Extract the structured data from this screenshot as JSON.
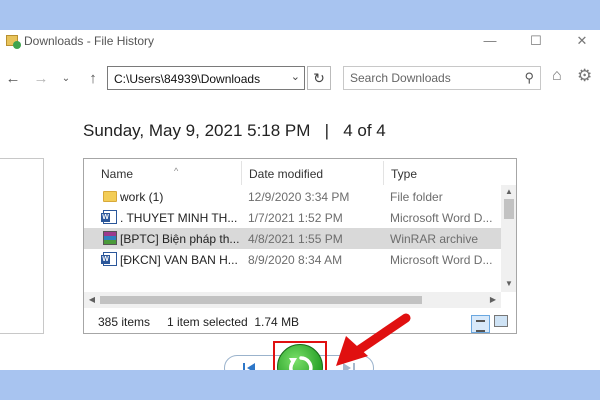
{
  "window": {
    "title": "Downloads - File History"
  },
  "window_controls": {
    "minimize": "—",
    "maximize": "☐",
    "close": "✕"
  },
  "nav": {
    "address": "C:\\Users\\84939\\Downloads",
    "search_placeholder": "Search Downloads"
  },
  "snapshot": {
    "date": "Sunday, May 9, 2021 5:18 PM",
    "separator": "|",
    "position": "4 of 4"
  },
  "columns": {
    "name": "Name",
    "date": "Date modified",
    "type": "Type"
  },
  "files": [
    {
      "name": "work (1)",
      "date": "12/9/2020 3:34 PM",
      "type": "File folder",
      "icon": "folder-icon",
      "selected": false
    },
    {
      "name": ". THUYET MINH TH...",
      "date": "1/7/2021 1:52 PM",
      "type": "Microsoft Word D...",
      "icon": "word-document-icon",
      "selected": false
    },
    {
      "name": "[BPTC] Biện pháp th...",
      "date": "4/8/2021 1:55 PM",
      "type": "WinRAR archive",
      "icon": "winrar-archive-icon",
      "selected": true
    },
    {
      "name": "[ĐKCN] VAN BAN H...",
      "date": "8/9/2020 8:34 AM",
      "type": "Microsoft Word D...",
      "icon": "word-document-icon",
      "selected": false
    }
  ],
  "status": {
    "item_count": "385 items",
    "selection": "1 item selected  1.74 MB"
  },
  "colors": {
    "accent_highlight": "#e01010",
    "restore_green": "#2ca42b",
    "background": "#a8c4f0"
  }
}
